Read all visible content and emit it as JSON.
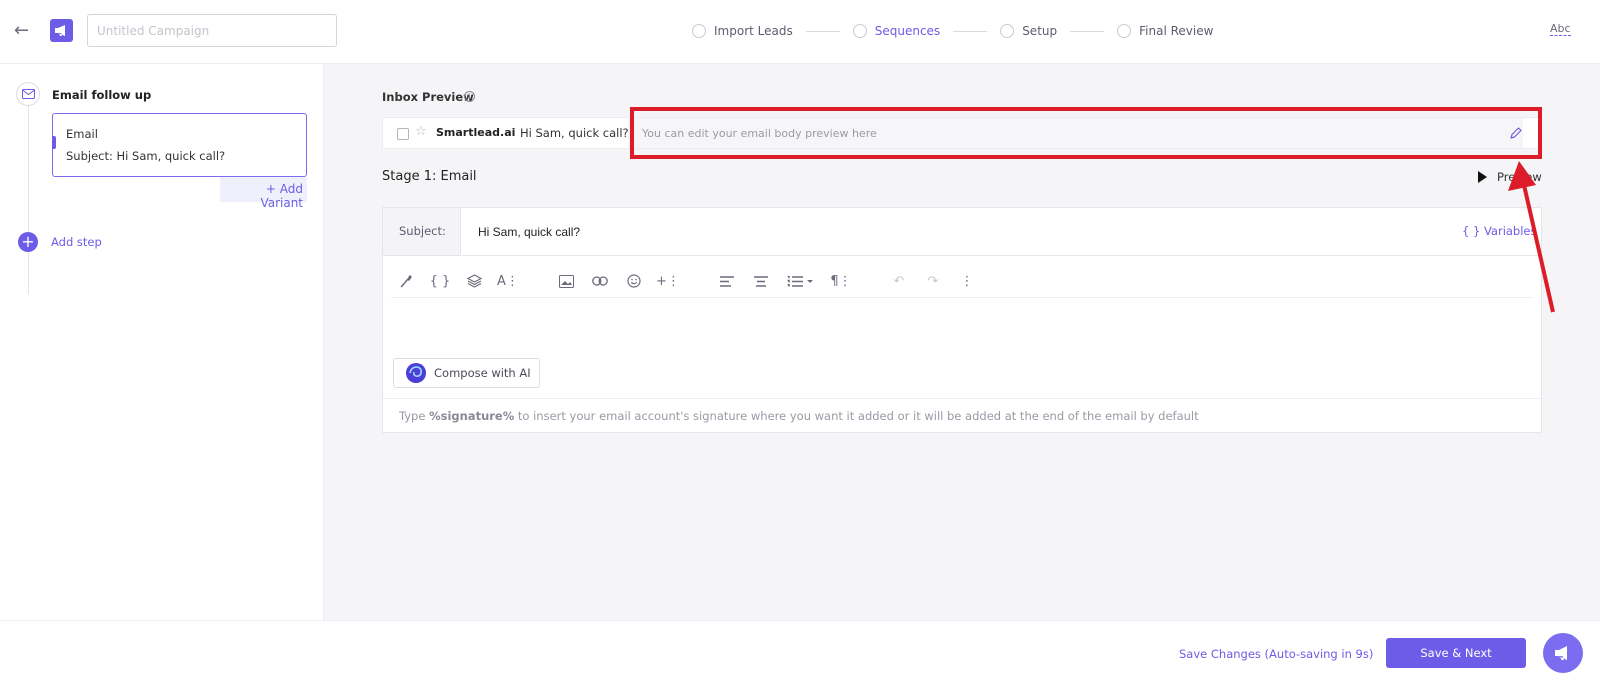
{
  "header": {
    "campaign_placeholder": "Untitled Campaign",
    "steps": [
      {
        "label": "Import Leads"
      },
      {
        "label": "Sequences"
      },
      {
        "label": "Setup"
      },
      {
        "label": "Final Review"
      }
    ],
    "active_step": "Sequences",
    "spell_check_label": "Abc"
  },
  "sidebar": {
    "sequence_title": "Email follow up",
    "variant": {
      "type": "Email",
      "subject": "Subject: Hi Sam, quick call?"
    },
    "add_variant_label": "+ Add Variant",
    "add_step_label": "Add step"
  },
  "inbox_preview": {
    "title": "Inbox Preview",
    "sender": "Smartlead.ai",
    "subject": "Hi Sam, quick call?",
    "body_placeholder": "You can edit your email body preview here"
  },
  "stage": {
    "title": "Stage 1: Email",
    "preview_label": "Preview",
    "subject_label": "Subject:",
    "subject_value": "Hi Sam, quick call?",
    "variables_label": "{ } Variables",
    "compose_ai_label": "Compose with AI",
    "signature_hint_prefix": "Type ",
    "signature_token": "%signature%",
    "signature_hint_suffix": " to insert your email account's signature where you want it added or it will be added at the end of the email by default"
  },
  "footer": {
    "autosave_label": "Save Changes (Auto-saving in 9s)",
    "save_next_label": "Save & Next"
  },
  "colors": {
    "accent": "#6c5ce7",
    "annotation_red": "#dd1c2a"
  }
}
